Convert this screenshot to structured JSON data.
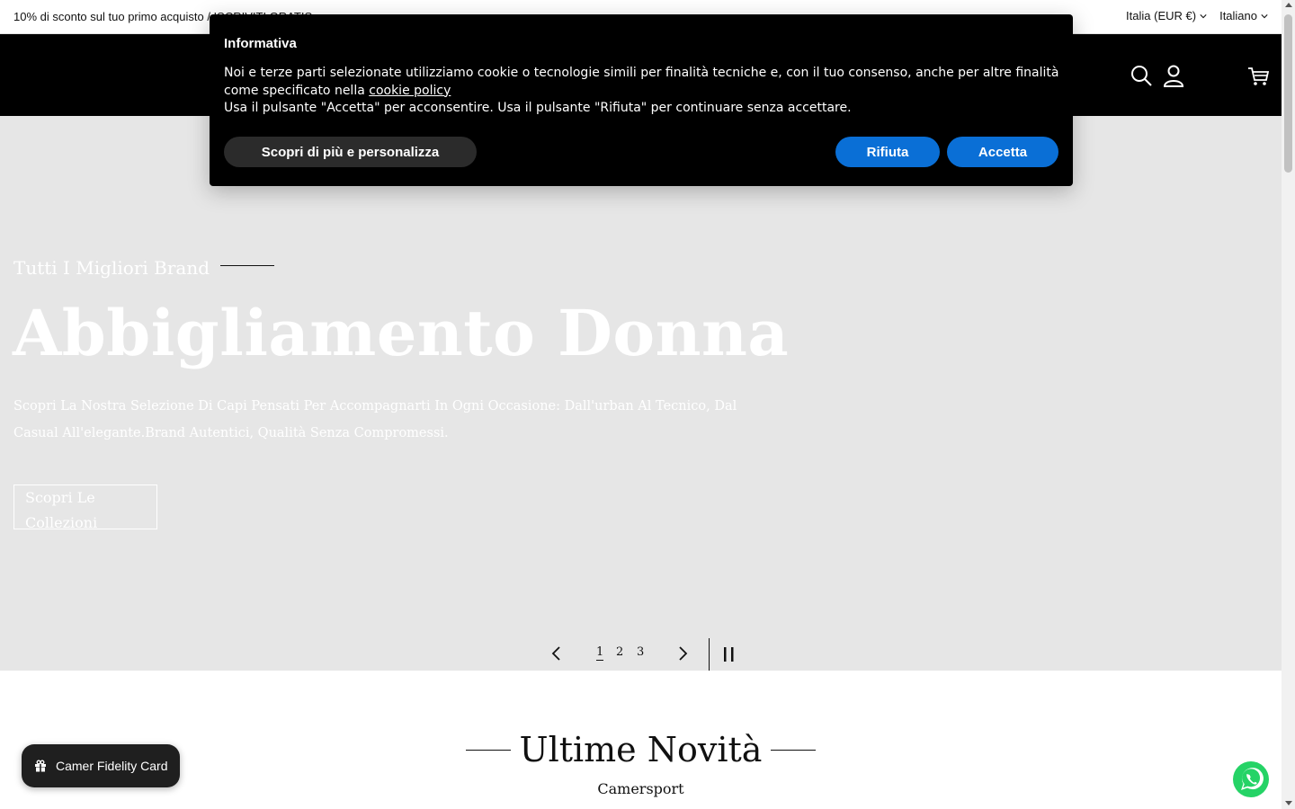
{
  "announcement": {
    "promo_text": "10% di sconto sul tuo primo acquisto / ISCRIVITI GRATIS",
    "country_selector": "Italia (EUR €)",
    "language_selector": "Italiano"
  },
  "header": {
    "icons": [
      "search-icon",
      "account-icon",
      "cart-icon"
    ],
    "background": "#000000"
  },
  "hero": {
    "eyebrow": "Tutti I Migliori Brand",
    "title": "Abbigliamento Donna",
    "description": "Scopri La Nostra Selezione Di Capi Pensati Per Accompagnarti In Ogni Occasione: Dall'urban Al Tecnico, Dal Casual All'elegante.Brand Autentici, Qualità Senza Compromessi.",
    "cta_label": "Scopri Le Collezioni",
    "background": "#e6e6e6",
    "slider": {
      "slides": [
        "1",
        "2",
        "3"
      ],
      "current": "1"
    }
  },
  "section": {
    "title": "Ultime Novità",
    "subtitle": "Camersport"
  },
  "cookie_banner": {
    "heading": "Informativa",
    "body_before_link": "Noi e terze parti selezionate utilizziamo cookie o tecnologie simili per finalità tecniche e, con il tuo consenso, anche per altre finalità come specificato nella ",
    "link_text": "cookie policy",
    "body_after_link": "Usa il pulsante \"Accetta\" per acconsentire. Usa il pulsante \"Rifiuta\" per continuare senza accettare.",
    "learn_more_label": "Scopri di più e personalizza",
    "reject_label": "Rifiuta",
    "accept_label": "Accetta",
    "accent_color": "#0a6fd6"
  },
  "fidelity_widget": {
    "label": "Camer Fidelity Card"
  },
  "whatsapp": {
    "icon": "whatsapp-icon",
    "color": "#25d366"
  }
}
